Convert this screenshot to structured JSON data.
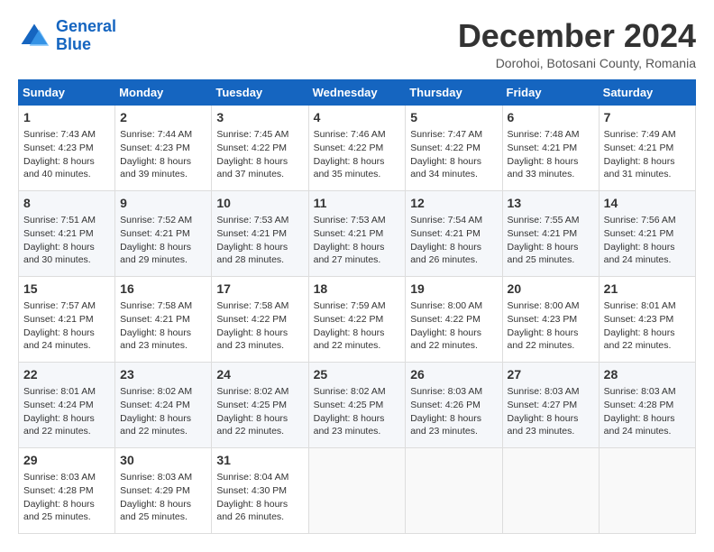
{
  "logo": {
    "line1": "General",
    "line2": "Blue"
  },
  "title": "December 2024",
  "subtitle": "Dorohoi, Botosani County, Romania",
  "weekdays": [
    "Sunday",
    "Monday",
    "Tuesday",
    "Wednesday",
    "Thursday",
    "Friday",
    "Saturday"
  ],
  "weeks": [
    [
      {
        "day": "1",
        "sunrise": "Sunrise: 7:43 AM",
        "sunset": "Sunset: 4:23 PM",
        "daylight": "Daylight: 8 hours and 40 minutes."
      },
      {
        "day": "2",
        "sunrise": "Sunrise: 7:44 AM",
        "sunset": "Sunset: 4:23 PM",
        "daylight": "Daylight: 8 hours and 39 minutes."
      },
      {
        "day": "3",
        "sunrise": "Sunrise: 7:45 AM",
        "sunset": "Sunset: 4:22 PM",
        "daylight": "Daylight: 8 hours and 37 minutes."
      },
      {
        "day": "4",
        "sunrise": "Sunrise: 7:46 AM",
        "sunset": "Sunset: 4:22 PM",
        "daylight": "Daylight: 8 hours and 35 minutes."
      },
      {
        "day": "5",
        "sunrise": "Sunrise: 7:47 AM",
        "sunset": "Sunset: 4:22 PM",
        "daylight": "Daylight: 8 hours and 34 minutes."
      },
      {
        "day": "6",
        "sunrise": "Sunrise: 7:48 AM",
        "sunset": "Sunset: 4:21 PM",
        "daylight": "Daylight: 8 hours and 33 minutes."
      },
      {
        "day": "7",
        "sunrise": "Sunrise: 7:49 AM",
        "sunset": "Sunset: 4:21 PM",
        "daylight": "Daylight: 8 hours and 31 minutes."
      }
    ],
    [
      {
        "day": "8",
        "sunrise": "Sunrise: 7:51 AM",
        "sunset": "Sunset: 4:21 PM",
        "daylight": "Daylight: 8 hours and 30 minutes."
      },
      {
        "day": "9",
        "sunrise": "Sunrise: 7:52 AM",
        "sunset": "Sunset: 4:21 PM",
        "daylight": "Daylight: 8 hours and 29 minutes."
      },
      {
        "day": "10",
        "sunrise": "Sunrise: 7:53 AM",
        "sunset": "Sunset: 4:21 PM",
        "daylight": "Daylight: 8 hours and 28 minutes."
      },
      {
        "day": "11",
        "sunrise": "Sunrise: 7:53 AM",
        "sunset": "Sunset: 4:21 PM",
        "daylight": "Daylight: 8 hours and 27 minutes."
      },
      {
        "day": "12",
        "sunrise": "Sunrise: 7:54 AM",
        "sunset": "Sunset: 4:21 PM",
        "daylight": "Daylight: 8 hours and 26 minutes."
      },
      {
        "day": "13",
        "sunrise": "Sunrise: 7:55 AM",
        "sunset": "Sunset: 4:21 PM",
        "daylight": "Daylight: 8 hours and 25 minutes."
      },
      {
        "day": "14",
        "sunrise": "Sunrise: 7:56 AM",
        "sunset": "Sunset: 4:21 PM",
        "daylight": "Daylight: 8 hours and 24 minutes."
      }
    ],
    [
      {
        "day": "15",
        "sunrise": "Sunrise: 7:57 AM",
        "sunset": "Sunset: 4:21 PM",
        "daylight": "Daylight: 8 hours and 24 minutes."
      },
      {
        "day": "16",
        "sunrise": "Sunrise: 7:58 AM",
        "sunset": "Sunset: 4:21 PM",
        "daylight": "Daylight: 8 hours and 23 minutes."
      },
      {
        "day": "17",
        "sunrise": "Sunrise: 7:58 AM",
        "sunset": "Sunset: 4:22 PM",
        "daylight": "Daylight: 8 hours and 23 minutes."
      },
      {
        "day": "18",
        "sunrise": "Sunrise: 7:59 AM",
        "sunset": "Sunset: 4:22 PM",
        "daylight": "Daylight: 8 hours and 22 minutes."
      },
      {
        "day": "19",
        "sunrise": "Sunrise: 8:00 AM",
        "sunset": "Sunset: 4:22 PM",
        "daylight": "Daylight: 8 hours and 22 minutes."
      },
      {
        "day": "20",
        "sunrise": "Sunrise: 8:00 AM",
        "sunset": "Sunset: 4:23 PM",
        "daylight": "Daylight: 8 hours and 22 minutes."
      },
      {
        "day": "21",
        "sunrise": "Sunrise: 8:01 AM",
        "sunset": "Sunset: 4:23 PM",
        "daylight": "Daylight: 8 hours and 22 minutes."
      }
    ],
    [
      {
        "day": "22",
        "sunrise": "Sunrise: 8:01 AM",
        "sunset": "Sunset: 4:24 PM",
        "daylight": "Daylight: 8 hours and 22 minutes."
      },
      {
        "day": "23",
        "sunrise": "Sunrise: 8:02 AM",
        "sunset": "Sunset: 4:24 PM",
        "daylight": "Daylight: 8 hours and 22 minutes."
      },
      {
        "day": "24",
        "sunrise": "Sunrise: 8:02 AM",
        "sunset": "Sunset: 4:25 PM",
        "daylight": "Daylight: 8 hours and 22 minutes."
      },
      {
        "day": "25",
        "sunrise": "Sunrise: 8:02 AM",
        "sunset": "Sunset: 4:25 PM",
        "daylight": "Daylight: 8 hours and 23 minutes."
      },
      {
        "day": "26",
        "sunrise": "Sunrise: 8:03 AM",
        "sunset": "Sunset: 4:26 PM",
        "daylight": "Daylight: 8 hours and 23 minutes."
      },
      {
        "day": "27",
        "sunrise": "Sunrise: 8:03 AM",
        "sunset": "Sunset: 4:27 PM",
        "daylight": "Daylight: 8 hours and 23 minutes."
      },
      {
        "day": "28",
        "sunrise": "Sunrise: 8:03 AM",
        "sunset": "Sunset: 4:28 PM",
        "daylight": "Daylight: 8 hours and 24 minutes."
      }
    ],
    [
      {
        "day": "29",
        "sunrise": "Sunrise: 8:03 AM",
        "sunset": "Sunset: 4:28 PM",
        "daylight": "Daylight: 8 hours and 25 minutes."
      },
      {
        "day": "30",
        "sunrise": "Sunrise: 8:03 AM",
        "sunset": "Sunset: 4:29 PM",
        "daylight": "Daylight: 8 hours and 25 minutes."
      },
      {
        "day": "31",
        "sunrise": "Sunrise: 8:04 AM",
        "sunset": "Sunset: 4:30 PM",
        "daylight": "Daylight: 8 hours and 26 minutes."
      },
      null,
      null,
      null,
      null
    ]
  ]
}
